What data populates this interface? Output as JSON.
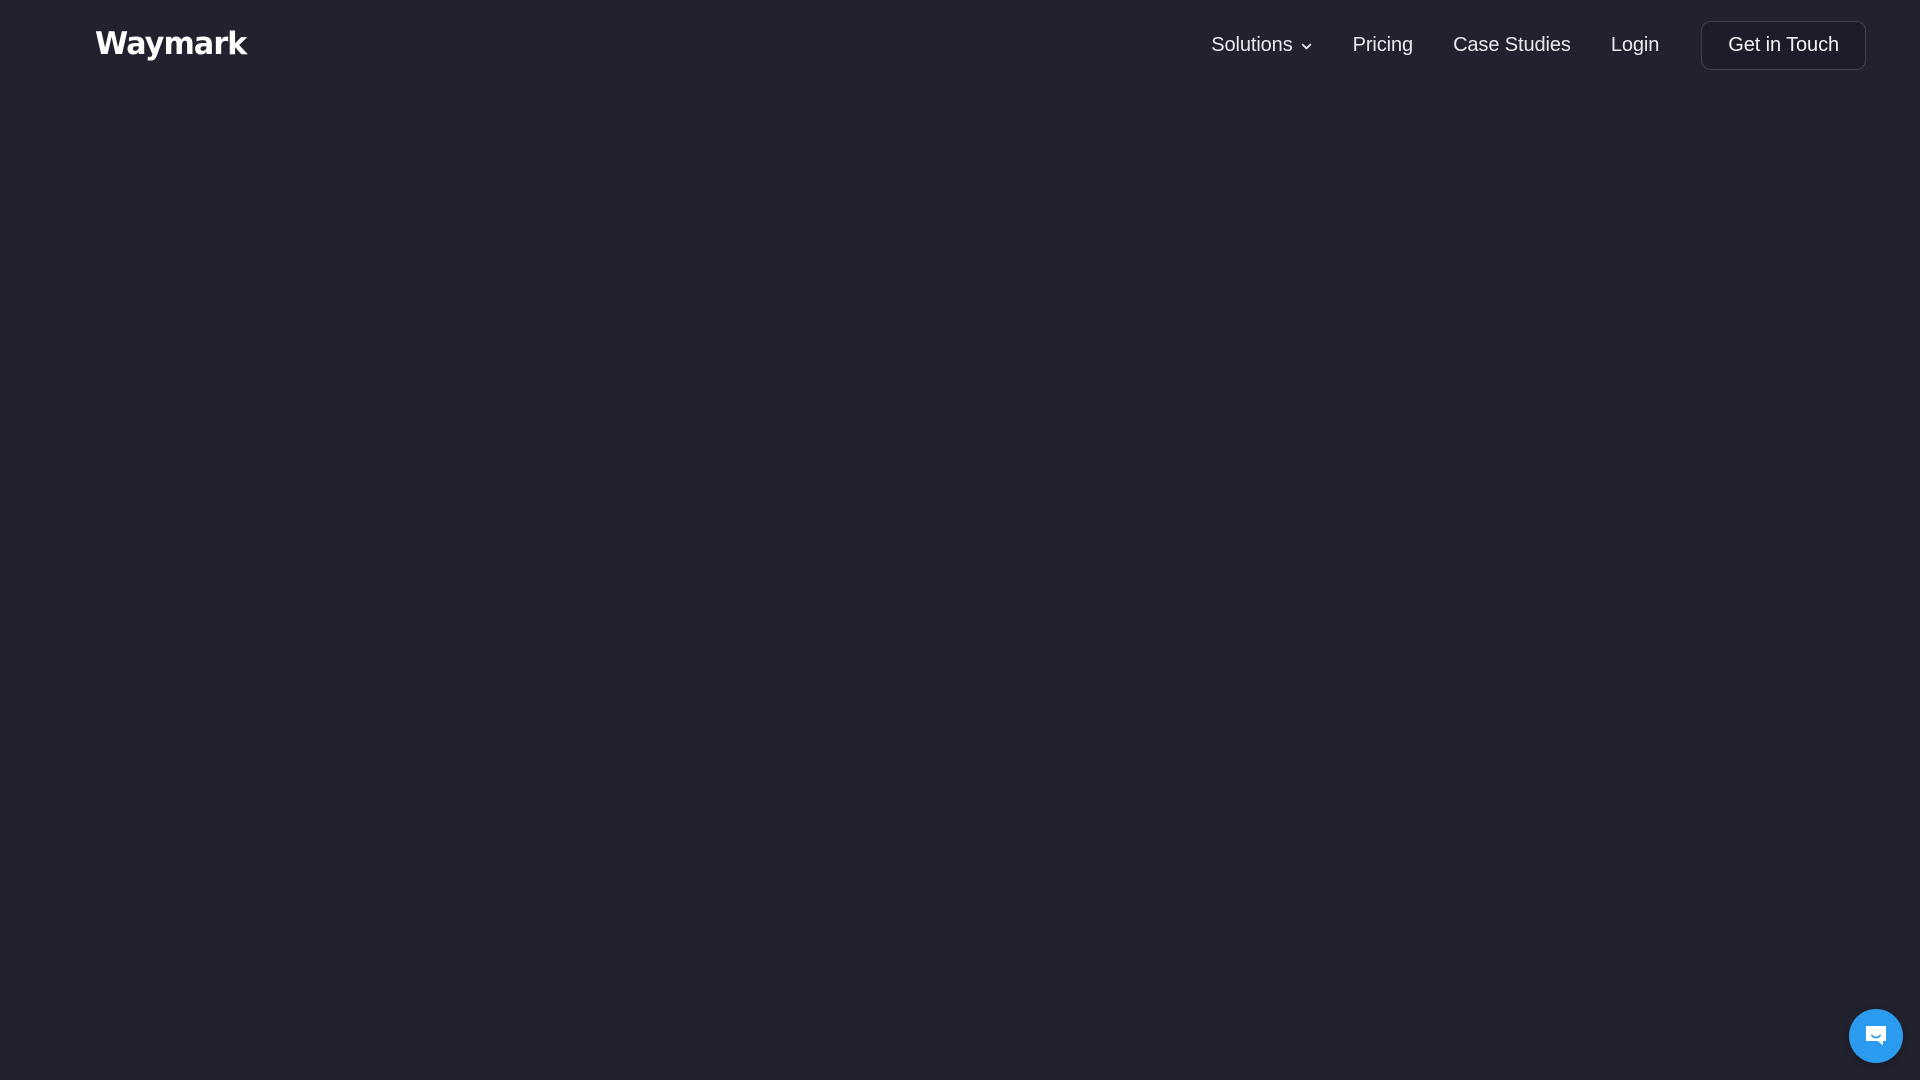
{
  "brand": {
    "logo_text": "Waymark",
    "logo_color": "#ffffff"
  },
  "theme": {
    "background": "#22222f",
    "nav_text": "#e9e9ef",
    "cta_border": "#42424f",
    "cta_background": "#1d1d29",
    "chat_accent": "#2b9bf0"
  },
  "header": {
    "nav": [
      {
        "label": "Solutions",
        "has_dropdown": true,
        "icon": "chevron-down-icon"
      },
      {
        "label": "Pricing",
        "has_dropdown": false
      },
      {
        "label": "Case Studies",
        "has_dropdown": false
      },
      {
        "label": "Login",
        "has_dropdown": false
      }
    ],
    "cta": {
      "label": "Get in Touch"
    }
  },
  "main": {
    "content": ""
  },
  "chat_widget": {
    "icon": "chat-bubble-smile-icon",
    "color": "#2b9bf0"
  }
}
